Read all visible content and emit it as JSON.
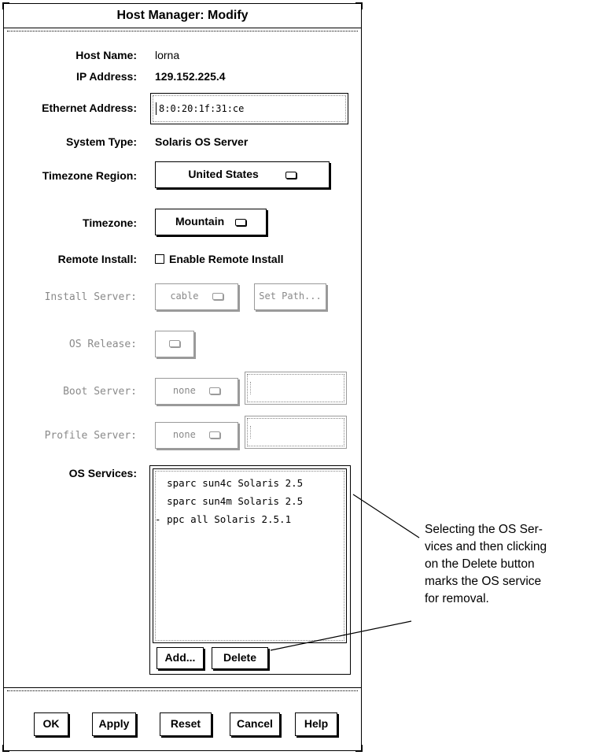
{
  "window": {
    "title": "Host Manager: Modify"
  },
  "fields": {
    "host_name": {
      "label": "Host Name:",
      "value": "lorna"
    },
    "ip_address": {
      "label": "IP Address:",
      "value": "129.152.225.4"
    },
    "ethernet_address": {
      "label": "Ethernet Address:",
      "value": "8:0:20:1f:31:ce"
    },
    "system_type": {
      "label": "System Type:",
      "value": "Solaris OS Server"
    },
    "timezone_region": {
      "label": "Timezone Region:",
      "value": "United States"
    },
    "timezone": {
      "label": "Timezone:",
      "value": "Mountain"
    },
    "remote_install": {
      "label": "Remote Install:",
      "checkbox_label": "Enable Remote Install",
      "checked": false
    },
    "install_server": {
      "label": "Install Server:",
      "value": "cable",
      "button": "Set Path..."
    },
    "os_release": {
      "label": "OS Release:",
      "value": ""
    },
    "boot_server": {
      "label": "Boot Server:",
      "value": "none",
      "text": ""
    },
    "profile_server": {
      "label": "Profile Server:",
      "value": "none",
      "text": ""
    }
  },
  "os_services": {
    "label": "OS Services:",
    "items": [
      {
        "marker": " ",
        "text": "sparc sun4c Solaris 2.5"
      },
      {
        "marker": " ",
        "text": "sparc sun4m Solaris 2.5"
      },
      {
        "marker": "-",
        "text": "ppc all Solaris 2.5.1"
      }
    ],
    "add_button": "Add...",
    "delete_button": "Delete"
  },
  "footer": {
    "ok": "OK",
    "apply": "Apply",
    "reset": "Reset",
    "cancel": "Cancel",
    "help": "Help"
  },
  "annotation": {
    "lines": [
      "Selecting the OS Ser-",
      "vices and then clicking",
      "on the Delete button",
      "marks the OS service",
      "for removal."
    ]
  }
}
